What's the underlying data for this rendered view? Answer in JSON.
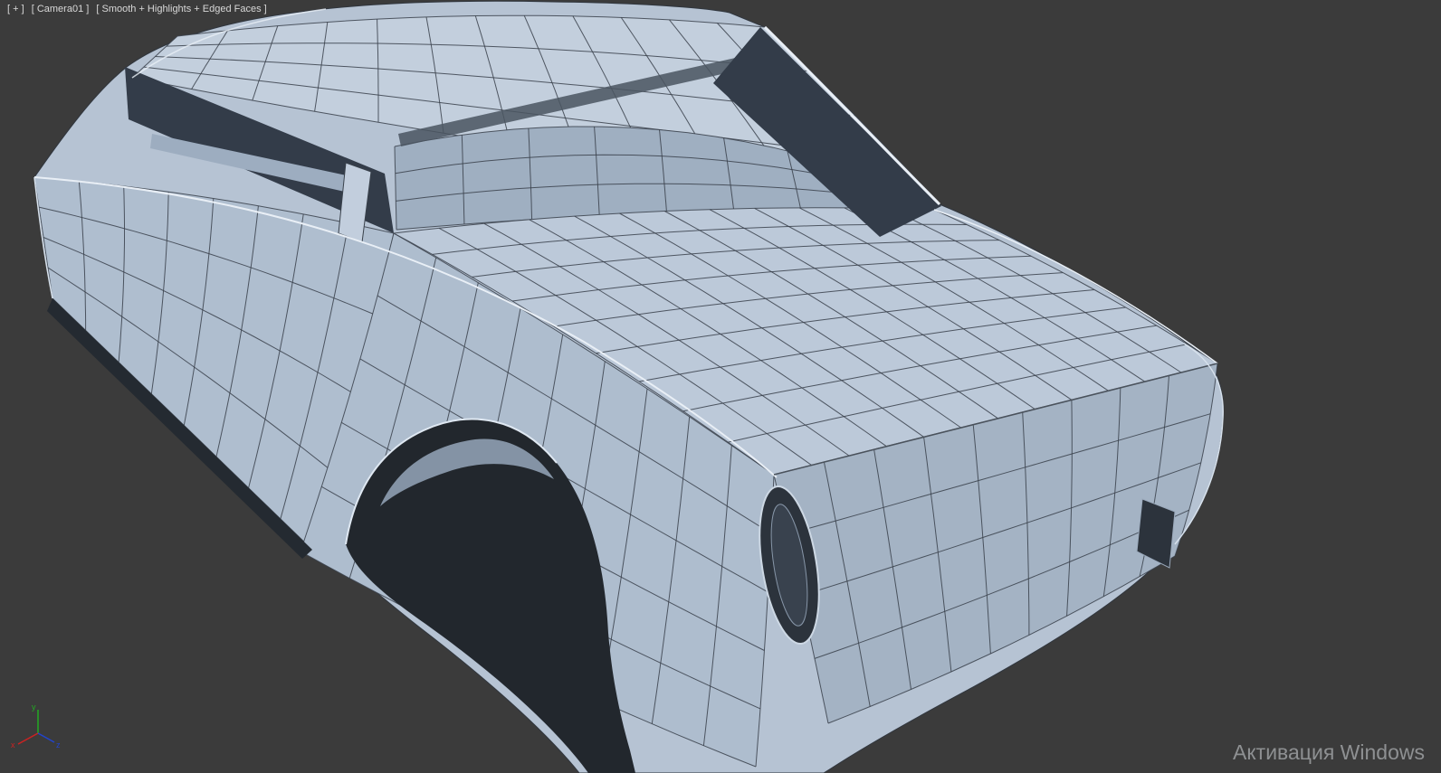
{
  "viewport": {
    "menus": {
      "general": "[ + ]",
      "pov": "[ Camera01 ]",
      "shading": "[ Smooth + Highlights + Edged Faces ]"
    }
  },
  "watermark": {
    "line1": "Активация Windows"
  },
  "axis_gizmo": {
    "x": "x",
    "y": "y",
    "z": "z"
  },
  "colors": {
    "background": "#3b3b3b",
    "body": "#b6c3d3",
    "wireframe": "#3a414b",
    "window_glass": "#333c49",
    "edge_highlight": "#e9eff6",
    "axis_x": "#cc2222",
    "axis_y": "#22aa22",
    "axis_z": "#2244cc"
  }
}
